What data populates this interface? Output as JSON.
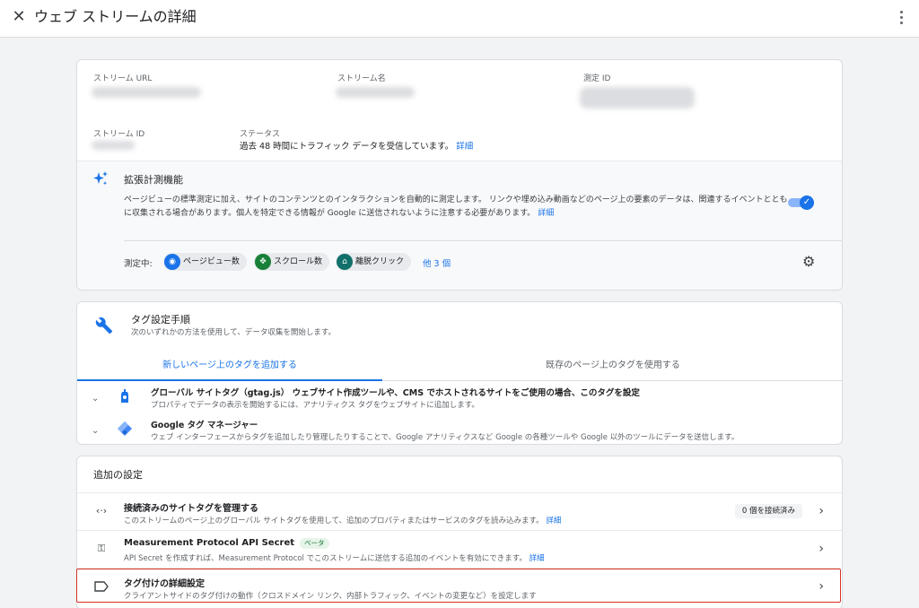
{
  "header": {
    "title": "ウェブ ストリームの詳細"
  },
  "stream_info": {
    "url_label": "ストリーム URL",
    "name_label": "ストリーム名",
    "measurement_id_label": "測定 ID",
    "stream_id_label": "ストリーム ID",
    "status_label": "ステータス",
    "status_text": "過去 48 時間にトラフィック データを受信しています。",
    "status_link": "詳細"
  },
  "enhanced": {
    "title": "拡張計測機能",
    "description": "ページビューの標準測定に加え、サイトのコンテンツとのインタラクションを自動的に測定します。 リンクや埋め込み動画などのページ上の要素のデータは、関連するイベントとともに収集される場合があります。個人を特定できる情報が Google に送信されないように注意する必要があります。",
    "link": "詳細",
    "toggle_on": true,
    "measuring_label": "測定中:",
    "chips": [
      {
        "label": "ページビュー数",
        "icon": "eye-icon",
        "color": "#1a73e8"
      },
      {
        "label": "スクロール数",
        "icon": "scroll-icon",
        "color": "#188038"
      },
      {
        "label": "離脱クリック",
        "icon": "mouse-icon",
        "color": "#12706a"
      }
    ],
    "more": "他 3 個"
  },
  "tagging": {
    "title": "タグ設定手順",
    "subtitle": "次のいずれかの方法を使用して、データ収集を開始します。",
    "tabs": [
      "新しいページ上のタグを追加する",
      "既存のページ上のタグを使用する"
    ],
    "options": [
      {
        "title": "グローバル サイトタグ（gtag.js） ウェブサイト作成ツールや、CMS でホストされるサイトをご使用の場合、このタグを設定",
        "desc": "プロパティでデータの表示を開始するには、アナリティクス タグをウェブサイトに追加します。"
      },
      {
        "title": "Google タグ マネージャー",
        "desc": "ウェブ インターフェースからタグを追加したり管理したりすることで、Google アナリティクスなど Google の各種ツールや Google 以外のツールにデータを送信します。"
      }
    ]
  },
  "additional": {
    "title": "追加の設定",
    "rows": [
      {
        "title": "接続済みのサイトタグを管理する",
        "desc": "このストリームのページ上のグローバル サイトタグを使用して、追加のプロパティまたはサービスのタグを読み込みます。",
        "link": "詳細",
        "badge": "0 個を接続済み"
      },
      {
        "title": "Measurement Protocol API Secret",
        "beta": "ベータ",
        "desc": "API Secret を作成すれば、Measurement Protocol でこのストリームに送信する追加のイベントを有効にできます。",
        "link": "詳細"
      },
      {
        "title": "タグ付けの詳細設定",
        "desc": "クライアントサイドのタグ付けの動作（クロスドメイン リンク、内部トラフィック、イベントの変更など）を設定します"
      }
    ]
  }
}
